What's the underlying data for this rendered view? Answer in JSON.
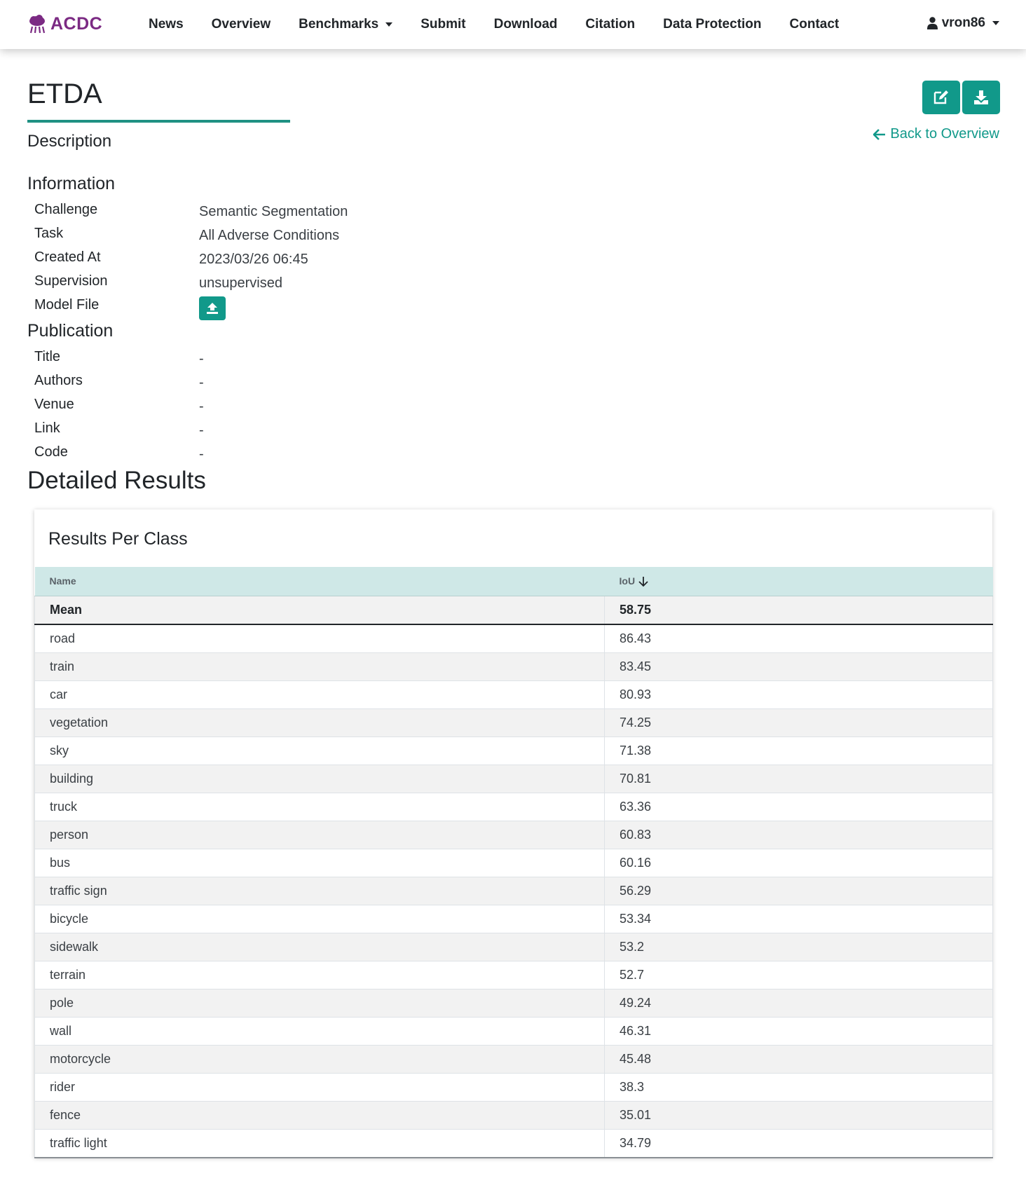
{
  "brand": {
    "name": "ACDC",
    "color": "#7b2a83",
    "icon": "cloud-rain-icon"
  },
  "nav": {
    "items": [
      "News",
      "Overview",
      "Benchmarks",
      "Submit",
      "Download",
      "Citation",
      "Data Protection",
      "Contact"
    ]
  },
  "user": {
    "name": "vron86",
    "icon": "user-icon"
  },
  "accent_color": "#11998a",
  "page": {
    "title": "ETDA",
    "description_heading": "Description",
    "information_heading": "Information",
    "publication_heading": "Publication",
    "detailed_results_heading": "Detailed Results",
    "back_link": "Back to Overview"
  },
  "information": [
    {
      "label": "Challenge",
      "value": "Semantic Segmentation"
    },
    {
      "label": "Task",
      "value": "All Adverse Conditions"
    },
    {
      "label": "Created At",
      "value": "2023/03/26 06:45"
    },
    {
      "label": "Supervision",
      "value": "unsupervised"
    },
    {
      "label": "Model File",
      "value": ""
    }
  ],
  "publication": [
    {
      "label": "Title",
      "value": "-"
    },
    {
      "label": "Authors",
      "value": "-"
    },
    {
      "label": "Venue",
      "value": "-"
    },
    {
      "label": "Link",
      "value": "-"
    },
    {
      "label": "Code",
      "value": "-"
    }
  ],
  "results": {
    "title": "Results Per Class",
    "columns": [
      "Name",
      "IoU"
    ],
    "mean": {
      "name": "Mean",
      "iou": "58.75"
    },
    "rows": [
      {
        "name": "road",
        "iou": "86.43"
      },
      {
        "name": "train",
        "iou": "83.45"
      },
      {
        "name": "car",
        "iou": "80.93"
      },
      {
        "name": "vegetation",
        "iou": "74.25"
      },
      {
        "name": "sky",
        "iou": "71.38"
      },
      {
        "name": "building",
        "iou": "70.81"
      },
      {
        "name": "truck",
        "iou": "63.36"
      },
      {
        "name": "person",
        "iou": "60.83"
      },
      {
        "name": "bus",
        "iou": "60.16"
      },
      {
        "name": "traffic sign",
        "iou": "56.29"
      },
      {
        "name": "bicycle",
        "iou": "53.34"
      },
      {
        "name": "sidewalk",
        "iou": "53.2"
      },
      {
        "name": "terrain",
        "iou": "52.7"
      },
      {
        "name": "pole",
        "iou": "49.24"
      },
      {
        "name": "wall",
        "iou": "46.31"
      },
      {
        "name": "motorcycle",
        "iou": "45.48"
      },
      {
        "name": "rider",
        "iou": "38.3"
      },
      {
        "name": "fence",
        "iou": "35.01"
      },
      {
        "name": "traffic light",
        "iou": "34.79"
      }
    ]
  }
}
